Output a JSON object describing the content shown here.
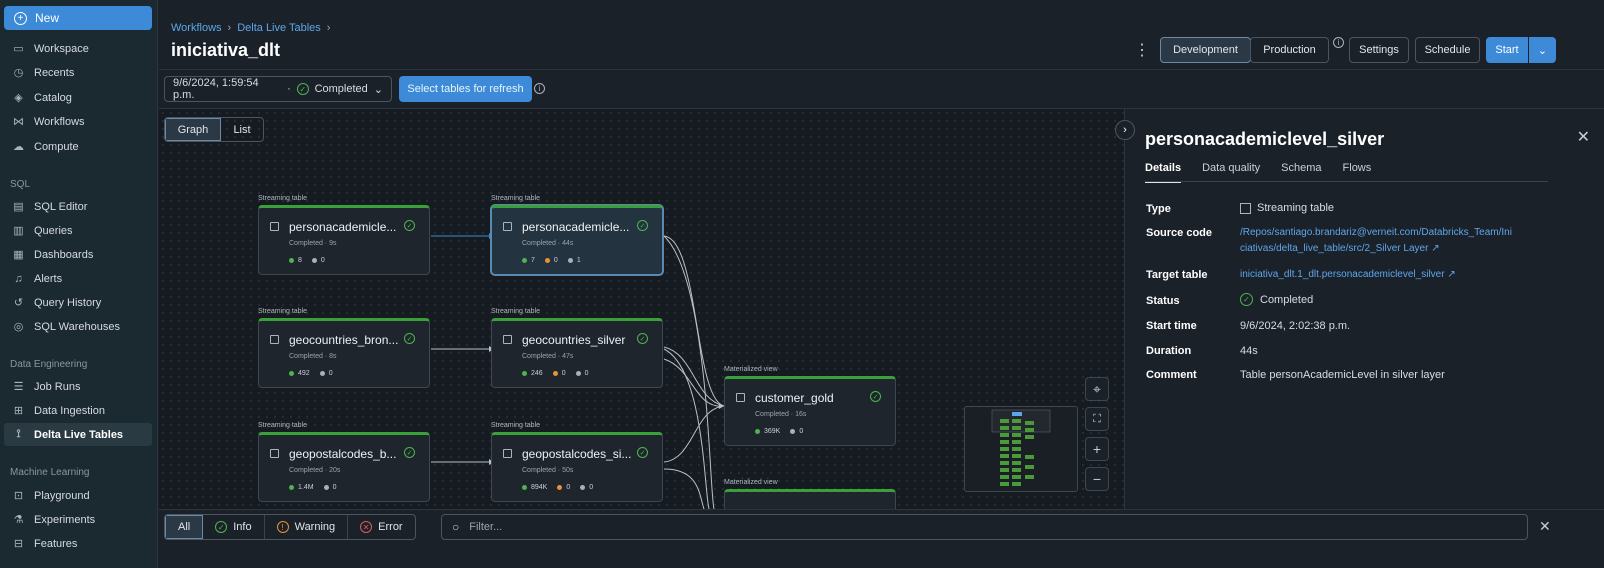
{
  "sidebar": {
    "new_label": "New",
    "items": [
      {
        "label": "Workspace",
        "icon": "folder-icon"
      },
      {
        "label": "Recents",
        "icon": "clock-icon"
      },
      {
        "label": "Catalog",
        "icon": "catalog-icon"
      },
      {
        "label": "Workflows",
        "icon": "workflows-icon"
      },
      {
        "label": "Compute",
        "icon": "cloud-icon"
      }
    ],
    "sql_section": "SQL",
    "sql_items": [
      {
        "label": "SQL Editor",
        "icon": "editor-icon"
      },
      {
        "label": "Queries",
        "icon": "queries-icon"
      },
      {
        "label": "Dashboards",
        "icon": "dashboards-icon"
      },
      {
        "label": "Alerts",
        "icon": "bell-icon"
      },
      {
        "label": "Query History",
        "icon": "history-icon"
      },
      {
        "label": "SQL Warehouses",
        "icon": "warehouse-icon"
      }
    ],
    "de_section": "Data Engineering",
    "de_items": [
      {
        "label": "Job Runs",
        "icon": "list-icon"
      },
      {
        "label": "Data Ingestion",
        "icon": "ingestion-icon"
      },
      {
        "label": "Delta Live Tables",
        "icon": "pipeline-icon"
      }
    ],
    "ml_section": "Machine Learning",
    "ml_items": [
      {
        "label": "Playground",
        "icon": "playground-icon"
      },
      {
        "label": "Experiments",
        "icon": "flask-icon"
      },
      {
        "label": "Features",
        "icon": "features-icon"
      }
    ]
  },
  "breadcrumb": {
    "item1": "Workflows",
    "item2": "Delta Live Tables"
  },
  "page_title": "iniciativa_dlt",
  "header": {
    "development": "Development",
    "production": "Production",
    "settings": "Settings",
    "schedule": "Schedule",
    "start": "Start"
  },
  "run": {
    "timestamp": "9/6/2024, 1:59:54 p.m.",
    "status": "Completed",
    "refresh_label": "Select tables for refresh"
  },
  "view_tabs": {
    "graph": "Graph",
    "list": "List"
  },
  "graph": {
    "nodes": [
      {
        "kind": "Streaming table",
        "name": "personacademicle...",
        "status": "Completed · 9s",
        "c1": "8",
        "c2": "0"
      },
      {
        "kind": "Streaming table",
        "name": "personacademicle...",
        "status": "Completed · 44s",
        "c1": "7",
        "c2": "0",
        "c3": "1"
      },
      {
        "kind": "Streaming table",
        "name": "geocountries_bron...",
        "status": "Completed · 8s",
        "c1": "492",
        "c2": "0"
      },
      {
        "kind": "Streaming table",
        "name": "geocountries_silver",
        "status": "Completed · 47s",
        "c1": "246",
        "c2": "0",
        "c3": "0"
      },
      {
        "kind": "Materialized view",
        "name": "customer_gold",
        "status": "Completed · 16s",
        "c1": "369K",
        "c2": "0"
      },
      {
        "kind": "Streaming table",
        "name": "geopostalcodes_b...",
        "status": "Completed · 20s",
        "c1": "1.4M",
        "c2": "0"
      },
      {
        "kind": "Streaming table",
        "name": "geopostalcodes_si...",
        "status": "Completed · 50s",
        "c1": "894K",
        "c2": "0",
        "c3": "0"
      },
      {
        "kind": "Materialized view"
      }
    ]
  },
  "details": {
    "title": "personacademiclevel_silver",
    "tabs": [
      "Details",
      "Data quality",
      "Schema",
      "Flows"
    ],
    "type_label": "Type",
    "type_value": "Streaming table",
    "source_label": "Source code",
    "source_line1": "/Repos/santiago.brandariz@verneit.com/Databricks_Team/Ini",
    "source_line2": "ciativas/delta_live_table/src/2_Silver Layer",
    "target_label": "Target table",
    "target_value": "iniciativa_dlt.1_dlt.personacademiclevel_silver",
    "status_label": "Status",
    "status_value": "Completed",
    "start_label": "Start time",
    "start_value": "9/6/2024, 2:02:38 p.m.",
    "duration_label": "Duration",
    "duration_value": "44s",
    "comment_label": "Comment",
    "comment_value": "Table personAcademicLevel in silver layer"
  },
  "footer": {
    "all": "All",
    "info": "Info",
    "warning": "Warning",
    "error": "Error",
    "filter_placeholder": "Filter..."
  },
  "colors": {
    "accent": "#3d8bd8",
    "success": "#3aa13a",
    "warning": "#e8913a",
    "error": "#e05a5a"
  }
}
